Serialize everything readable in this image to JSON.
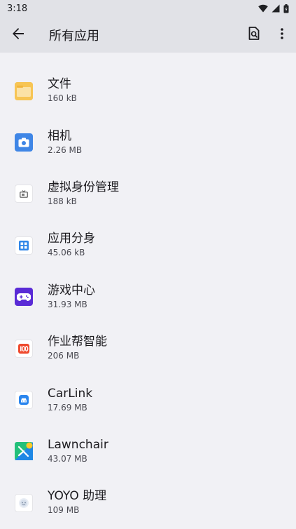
{
  "status": {
    "time": "3:18"
  },
  "header": {
    "title": "所有应用"
  },
  "apps": [
    {
      "name": "文件",
      "size": "160 kB",
      "icon": "folder-icon"
    },
    {
      "name": "相机",
      "size": "2.26 MB",
      "icon": "camera-icon"
    },
    {
      "name": "虚拟身份管理",
      "size": "188 kB",
      "icon": "tv-icon"
    },
    {
      "name": "应用分身",
      "size": "45.06 kB",
      "icon": "app-clone-icon"
    },
    {
      "name": "游戏中心",
      "size": "31.93 MB",
      "icon": "gamepad-icon"
    },
    {
      "name": "作业帮智能",
      "size": "206 MB",
      "icon": "homework-100-icon"
    },
    {
      "name": "CarLink",
      "size": "17.69 MB",
      "icon": "car-icon"
    },
    {
      "name": "Lawnchair",
      "size": "43.07 MB",
      "icon": "lawnchair-icon"
    },
    {
      "name": "YOYO 助理",
      "size": "109 MB",
      "icon": "yoyo-assistant-icon"
    }
  ],
  "colors": {
    "background": "#f1f1f5",
    "app_bar": "#e1e2e7"
  }
}
